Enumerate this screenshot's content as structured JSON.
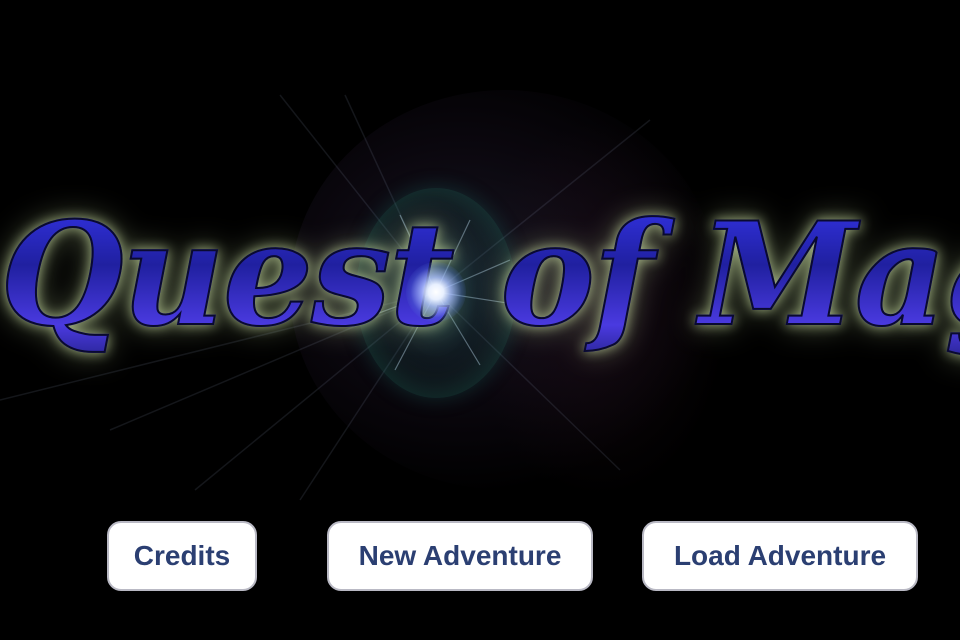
{
  "title_screen": {
    "game_title": "Quest of Magic",
    "accent_color": "#2a2ab8",
    "glow_color": "#c8dca0"
  },
  "menu": {
    "credits_label": "Credits",
    "new_adventure_label": "New Adventure",
    "load_adventure_label": "Load Adventure",
    "button_text_color": "#2b3f72"
  }
}
